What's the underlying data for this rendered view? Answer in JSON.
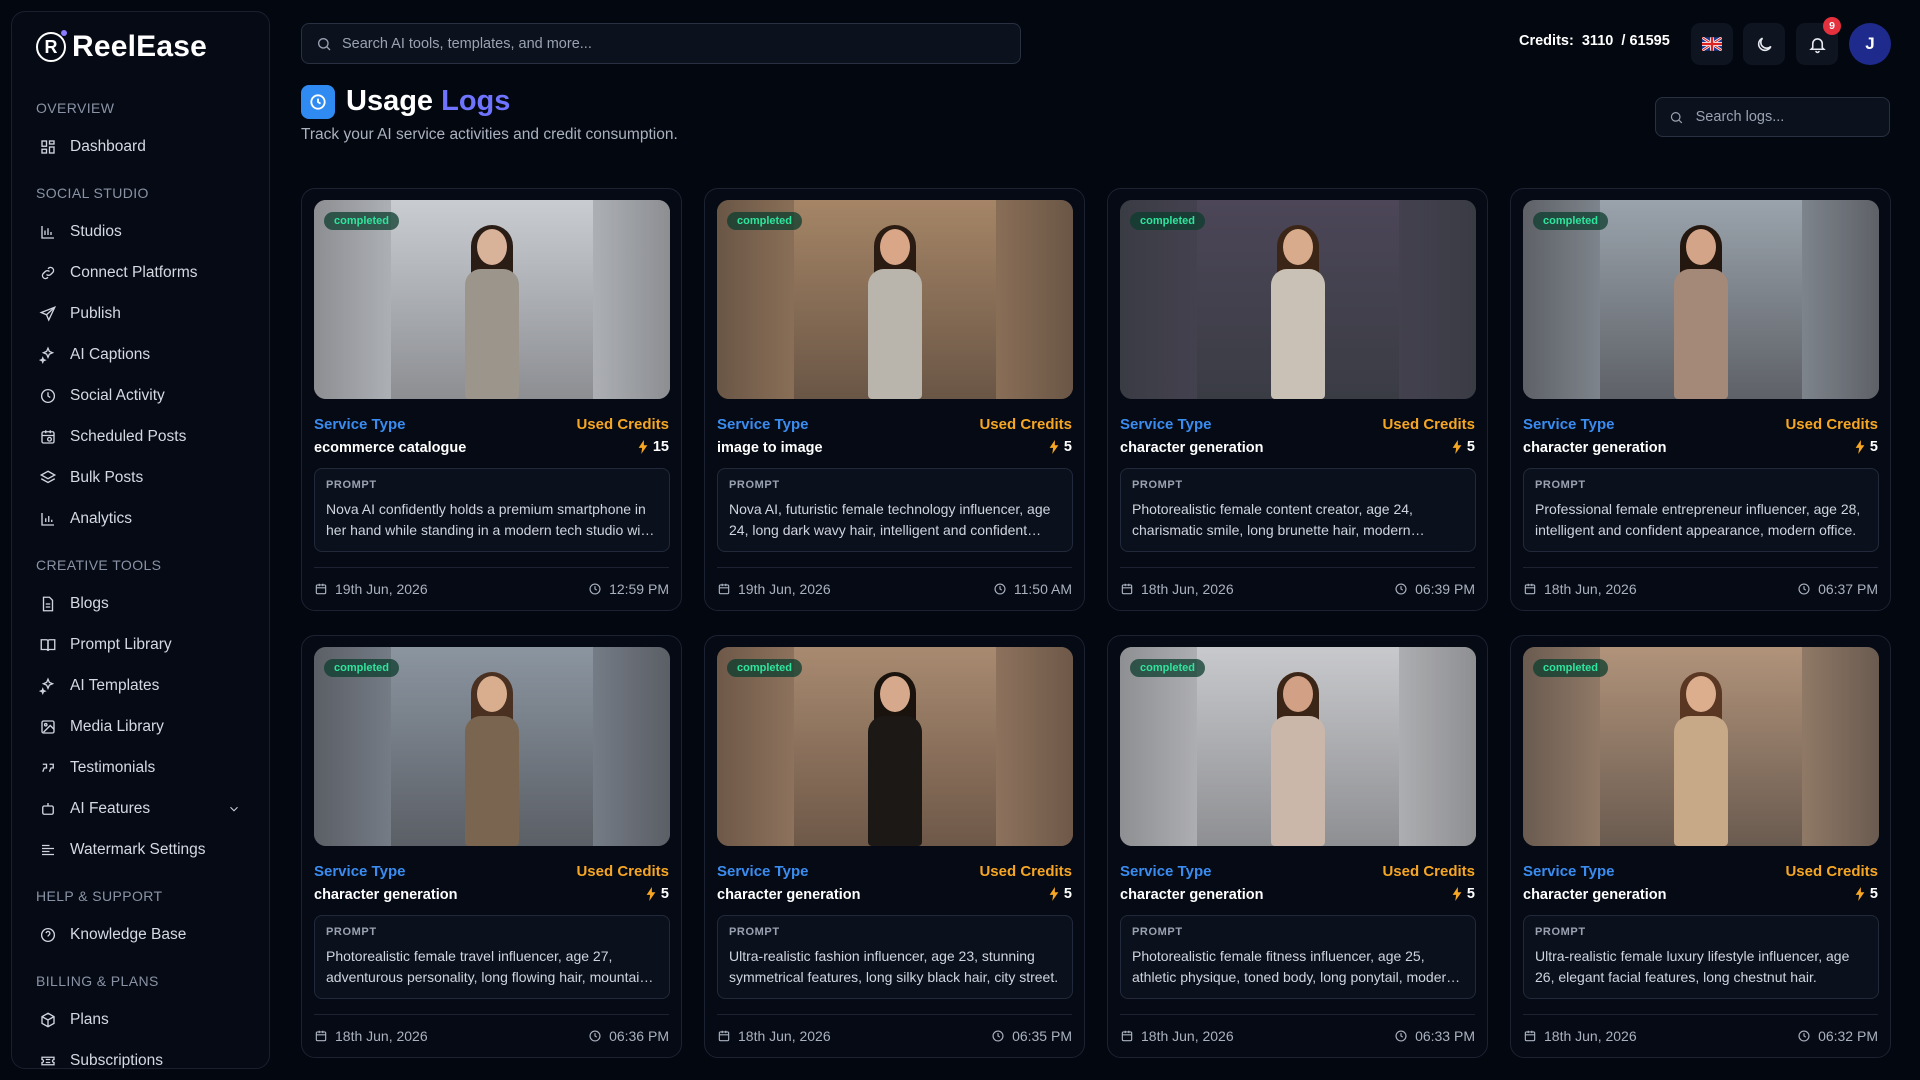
{
  "app": {
    "name": "ReelEase",
    "logo_letter": "R"
  },
  "sidebar": {
    "sections": [
      {
        "title": "OVERVIEW",
        "items": [
          {
            "label": "Dashboard",
            "icon": "dashboard-icon"
          }
        ]
      },
      {
        "title": "SOCIAL STUDIO",
        "items": [
          {
            "label": "Studios",
            "icon": "studio-icon"
          },
          {
            "label": "Connect Platforms",
            "icon": "link-icon"
          },
          {
            "label": "Publish",
            "icon": "send-icon"
          },
          {
            "label": "AI Captions",
            "icon": "sparkles-icon"
          },
          {
            "label": "Social Activity",
            "icon": "clock-icon"
          },
          {
            "label": "Scheduled Posts",
            "icon": "calendar-clock-icon"
          },
          {
            "label": "Bulk Posts",
            "icon": "layers-icon"
          },
          {
            "label": "Analytics",
            "icon": "bar-chart-icon"
          }
        ]
      },
      {
        "title": "CREATIVE TOOLS",
        "items": [
          {
            "label": "Blogs",
            "icon": "file-text-icon"
          },
          {
            "label": "Prompt Library",
            "icon": "book-open-icon"
          },
          {
            "label": "AI Templates",
            "icon": "sparkles-icon"
          },
          {
            "label": "Media Library",
            "icon": "image-icon"
          },
          {
            "label": "Testimonials",
            "icon": "quote-icon"
          },
          {
            "label": "AI Features",
            "icon": "bot-icon",
            "expandable": true
          },
          {
            "label": "Watermark Settings",
            "icon": "align-left-icon"
          }
        ]
      },
      {
        "title": "HELP & SUPPORT",
        "items": [
          {
            "label": "Knowledge Base",
            "icon": "help-circle-icon"
          }
        ]
      },
      {
        "title": "BILLING & PLANS",
        "items": [
          {
            "label": "Plans",
            "icon": "package-icon"
          },
          {
            "label": "Subscriptions",
            "icon": "ticket-icon"
          }
        ]
      }
    ]
  },
  "topbar": {
    "search_placeholder": "Search AI tools, templates, and more...",
    "credits_label": "Credits:",
    "credits_used": "3110",
    "credits_total": "/ 61595",
    "notification_count": "9",
    "avatar_initial": "J",
    "language": "GB"
  },
  "header": {
    "title_main": "Usage",
    "title_accent": "Logs",
    "subtitle": "Track your AI service activities and credit consumption.",
    "log_search_placeholder": "Search logs..."
  },
  "labels": {
    "service_type": "Service Type",
    "used_credits": "Used Credits",
    "prompt": "PROMPT"
  },
  "logs": [
    {
      "status": "completed",
      "service": "ecommerce catalogue",
      "credits": "15",
      "prompt": "Nova AI confidently holds a premium smartphone in her hand while standing in a modern tech studio with holographic displays around her.",
      "date": "19th Jun, 2026",
      "time": "12:59 PM",
      "bg": "#8c8e92",
      "scene": "#c9cdd2",
      "hair": "#2a1d16",
      "skin": "#d9b29a",
      "outfit": "#9b958c"
    },
    {
      "status": "completed",
      "service": "image to image",
      "credits": "5",
      "prompt": "Nova AI, futuristic female technology influencer, age 24, long dark wavy hair, intelligent and confident expression.",
      "date": "19th Jun, 2026",
      "time": "11:50 AM",
      "bg": "#6a5646",
      "scene": "#a58566",
      "hair": "#2b1c13",
      "skin": "#d9a787",
      "outfit": "#b9b4ac"
    },
    {
      "status": "completed",
      "service": "character generation",
      "credits": "5",
      "prompt": "Photorealistic female content creator, age 24, charismatic smile, long brunette hair, modern streaming setup.",
      "date": "18th Jun, 2026",
      "time": "06:39 PM",
      "bg": "#3a3c44",
      "scene": "#4c4658",
      "hair": "#3a2516",
      "skin": "#d8ab8c",
      "outfit": "#c9c0b6"
    },
    {
      "status": "completed",
      "service": "character generation",
      "credits": "5",
      "prompt": "Professional female entrepreneur influencer, age 28, intelligent and confident appearance, modern office.",
      "date": "18th Jun, 2026",
      "time": "06:37 PM",
      "bg": "#5e6167",
      "scene": "#9aa3ac",
      "hair": "#24170f",
      "skin": "#d4a488",
      "outfit": "#a48878"
    },
    {
      "status": "completed",
      "service": "character generation",
      "credits": "5",
      "prompt": "Photorealistic female travel influencer, age 27, adventurous personality, long flowing hair, mountain overlook.",
      "date": "18th Jun, 2026",
      "time": "06:36 PM",
      "bg": "#5b5f66",
      "scene": "#8b95a0",
      "hair": "#4a3020",
      "skin": "#d8ae8e",
      "outfit": "#7a6650"
    },
    {
      "status": "completed",
      "service": "character generation",
      "credits": "5",
      "prompt": "Ultra-realistic fashion influencer, age 23, stunning symmetrical features, long silky black hair, city street.",
      "date": "18th Jun, 2026",
      "time": "06:35 PM",
      "bg": "#6e5848",
      "scene": "#a88a70",
      "hair": "#1a120c",
      "skin": "#d7a98c",
      "outfit": "#1b1816"
    },
    {
      "status": "completed",
      "service": "character generation",
      "credits": "5",
      "prompt": "Photorealistic female fitness influencer, age 25, athletic physique, toned body, long ponytail, modern gym.",
      "date": "18th Jun, 2026",
      "time": "06:33 PM",
      "bg": "#8e8f92",
      "scene": "#c8c9cc",
      "hair": "#3b2517",
      "skin": "#d2a185",
      "outfit": "#cbb7aa"
    },
    {
      "status": "completed",
      "service": "character generation",
      "credits": "5",
      "prompt": "Ultra-realistic female luxury lifestyle influencer, age 26, elegant facial features, long chestnut hair.",
      "date": "18th Jun, 2026",
      "time": "06:32 PM",
      "bg": "#6a5b50",
      "scene": "#b1937a",
      "hair": "#5a3722",
      "skin": "#dcae8e",
      "outfit": "#c7a887"
    }
  ]
}
